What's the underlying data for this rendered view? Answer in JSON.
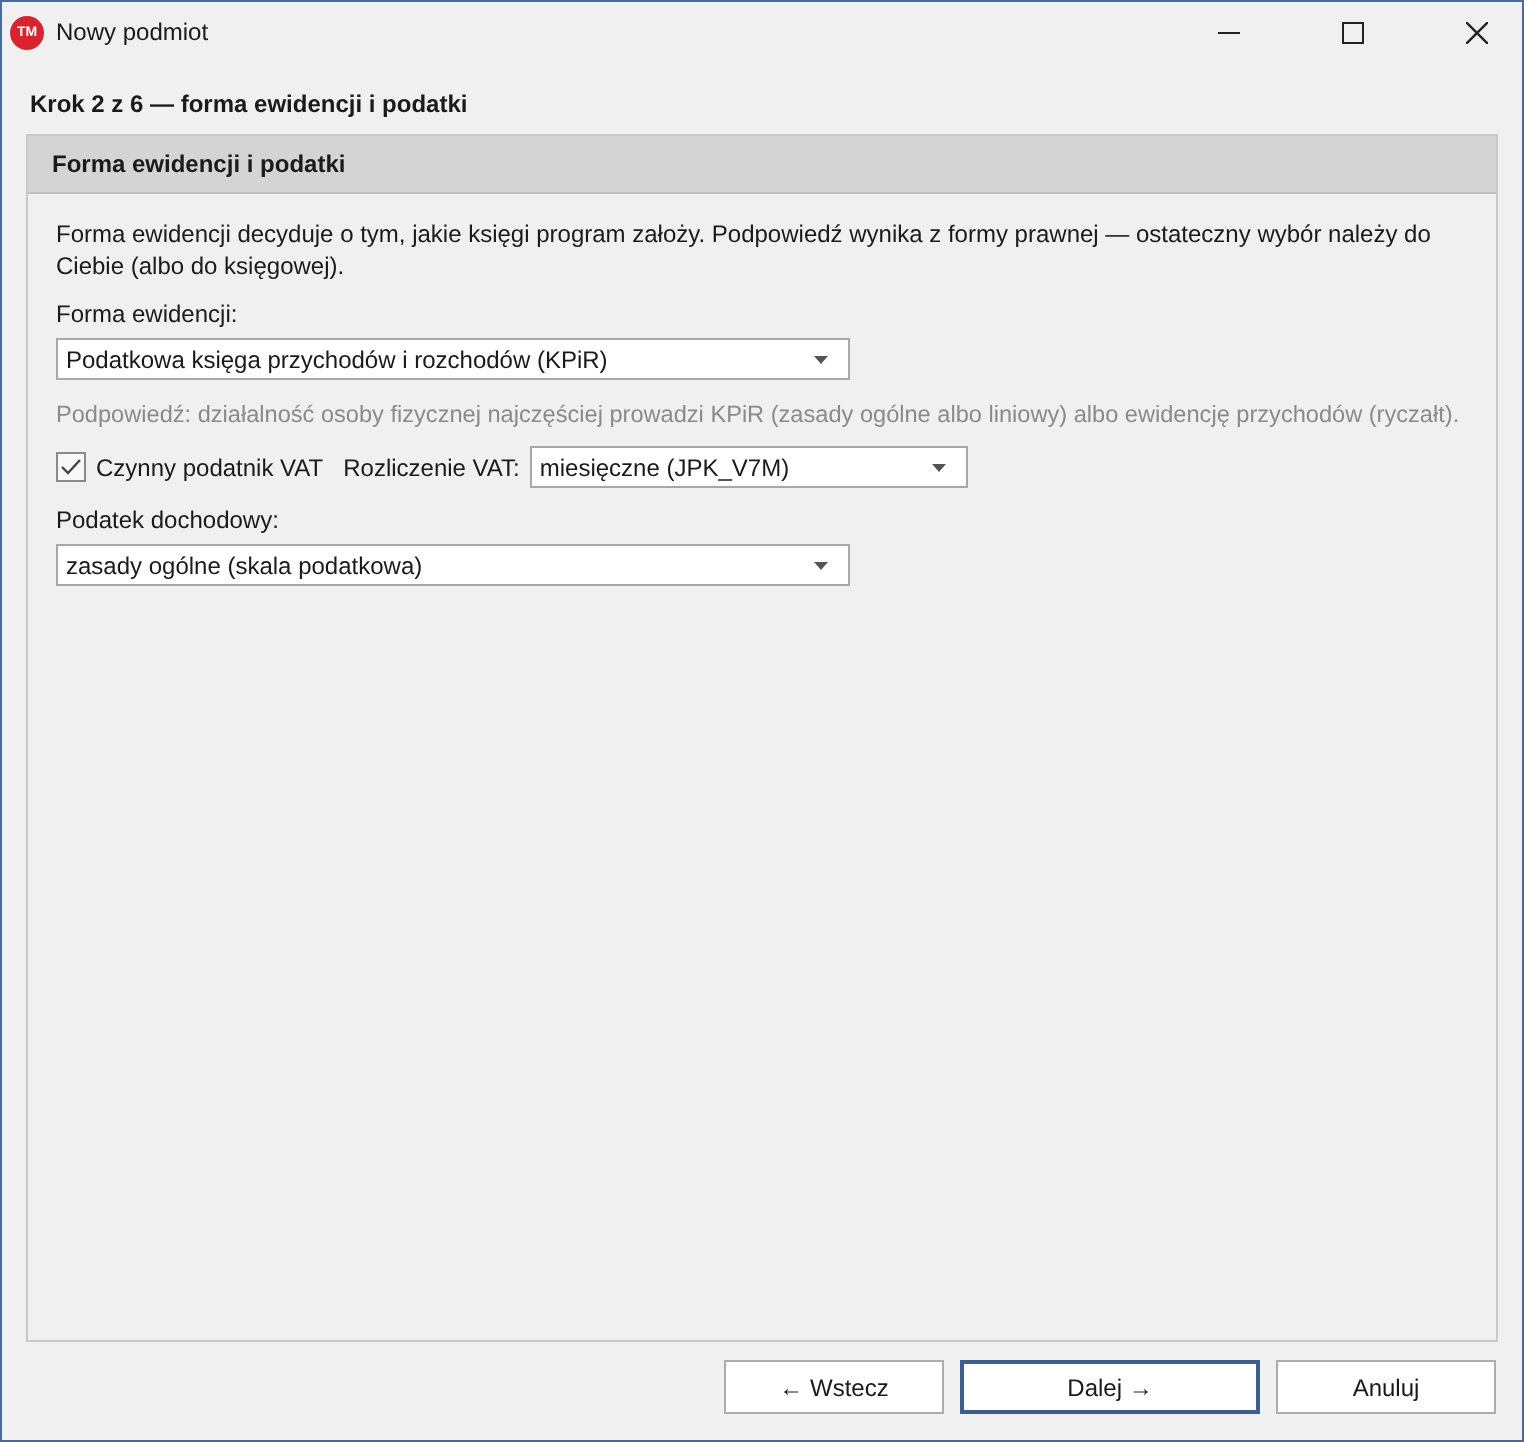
{
  "window": {
    "title": "Nowy podmiot",
    "logo": "TM"
  },
  "step_title": "Krok 2 z 6 — forma ewidencji i podatki",
  "panel": {
    "title": "Forma ewidencji i podatki",
    "description": "Forma ewidencji decyduje o tym, jakie księgi program założy. Podpowiedź wynika z formy prawnej — ostateczny wybór należy do Ciebie (albo do księgowej).",
    "form_label": "Forma ewidencji:",
    "form_value": "Podatkowa księga przychodów i rozchodów (KPiR)",
    "hint": "Podpowiedź: działalność osoby fizycznej najczęściej prowadzi KPiR (zasady ogólne albo liniowy) albo ewidencję przychodów (ryczałt).",
    "vat": {
      "checked": true,
      "label": "Czynny podatnik VAT",
      "settlement_label": "Rozliczenie VAT:",
      "settlement_value": "miesięczne (JPK_V7M)"
    },
    "income_label": "Podatek dochodowy:",
    "income_value": "zasady ogólne (skala podatkowa)"
  },
  "buttons": [
    {
      "label": "← Wstecz",
      "default": false
    },
    {
      "label": "Dalej →",
      "default": true
    },
    {
      "label": "Anuluj",
      "default": false
    }
  ]
}
